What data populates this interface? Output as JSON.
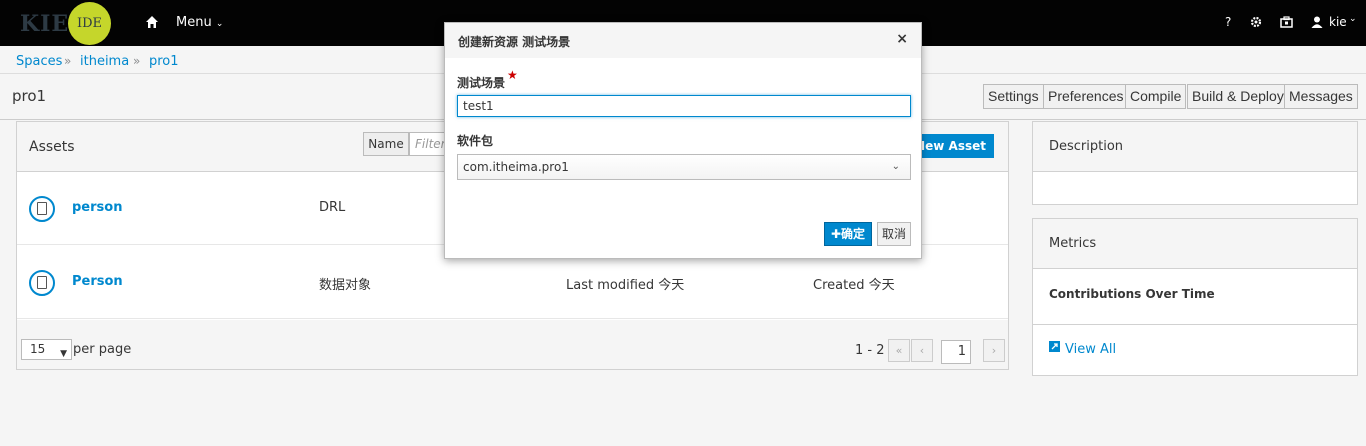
{
  "topbar": {
    "logo_text": "KIE",
    "logo_badge": "IDE",
    "menu_label": "Menu",
    "help_label": "?",
    "user_label": "kie"
  },
  "breadcrumb": [
    "Spaces",
    "itheima",
    "pro1"
  ],
  "project": {
    "title": "pro1",
    "toolbar": [
      "Settings",
      "Preferences",
      "Compile",
      "Build & Deploy",
      "Messages"
    ]
  },
  "assets": {
    "title": "Assets",
    "sort_label": "Name",
    "filter_placeholder": "Filter",
    "new_asset_label": "New Asset",
    "rows": [
      {
        "name": "person",
        "type": "DRL",
        "modified": "",
        "created": ""
      },
      {
        "name": "Person",
        "type": "数据对象",
        "modified": "Last modified 今天",
        "created": "Created 今天"
      }
    ],
    "per_page_value": "15",
    "per_page_label": "per page",
    "page_range": "1 - 2",
    "page_value": "1"
  },
  "sidebar": {
    "description_title": "Description",
    "metrics_title": "Metrics",
    "contributions_title": "Contributions Over Time",
    "view_all": "View All"
  },
  "modal": {
    "title": "创建新资源 测试场景",
    "close": "×",
    "name_label": "测试场景",
    "name_value": "test1",
    "package_label": "软件包",
    "package_value": "com.itheima.pro1",
    "ok_label": "确定",
    "cancel_label": "取消"
  }
}
